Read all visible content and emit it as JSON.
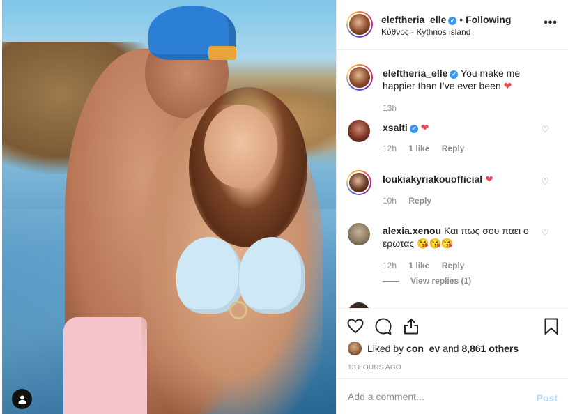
{
  "post": {
    "author": "eleftheria_elle",
    "follow_label": "Following",
    "location": "Κύθνος - Kythnos island",
    "more_label": "•••",
    "caption": {
      "username": "eleftheria_elle",
      "text": "You make me happier than I’ve ever been",
      "time": "13h"
    }
  },
  "comments": [
    {
      "username": "xsalti",
      "verified": true,
      "text": "",
      "time": "12h",
      "likes": "1 like",
      "reply": "Reply"
    },
    {
      "username": "loukiakyriakouofficial",
      "verified": false,
      "text": "",
      "time": "10h",
      "likes": "",
      "reply": "Reply"
    },
    {
      "username": "alexia.xenou",
      "verified": false,
      "text": "Και πως σου παει ο ερωτας",
      "emojis": "😘😘😘",
      "time": "12h",
      "likes": "1 like",
      "reply": "Reply",
      "view_replies": "View replies (1)"
    }
  ],
  "actions": {
    "liked_by_prefix": "Liked by",
    "liked_by_user": "con_ev",
    "liked_by_and": "and",
    "liked_by_count": "8,861 others",
    "timestamp": "13 HOURS AGO"
  },
  "composer": {
    "placeholder": "Add a comment...",
    "post_label": "Post"
  },
  "icons": {
    "verified": "verified-badge-icon",
    "heart": "heart-icon",
    "comment": "comment-icon",
    "share": "share-icon",
    "bookmark": "bookmark-icon",
    "user_tag": "user-tag-icon"
  },
  "colors": {
    "accent": "#3897f0",
    "like_red": "#ed4956",
    "muted": "#8e8e8e",
    "post_disabled": "#b3dbff"
  }
}
